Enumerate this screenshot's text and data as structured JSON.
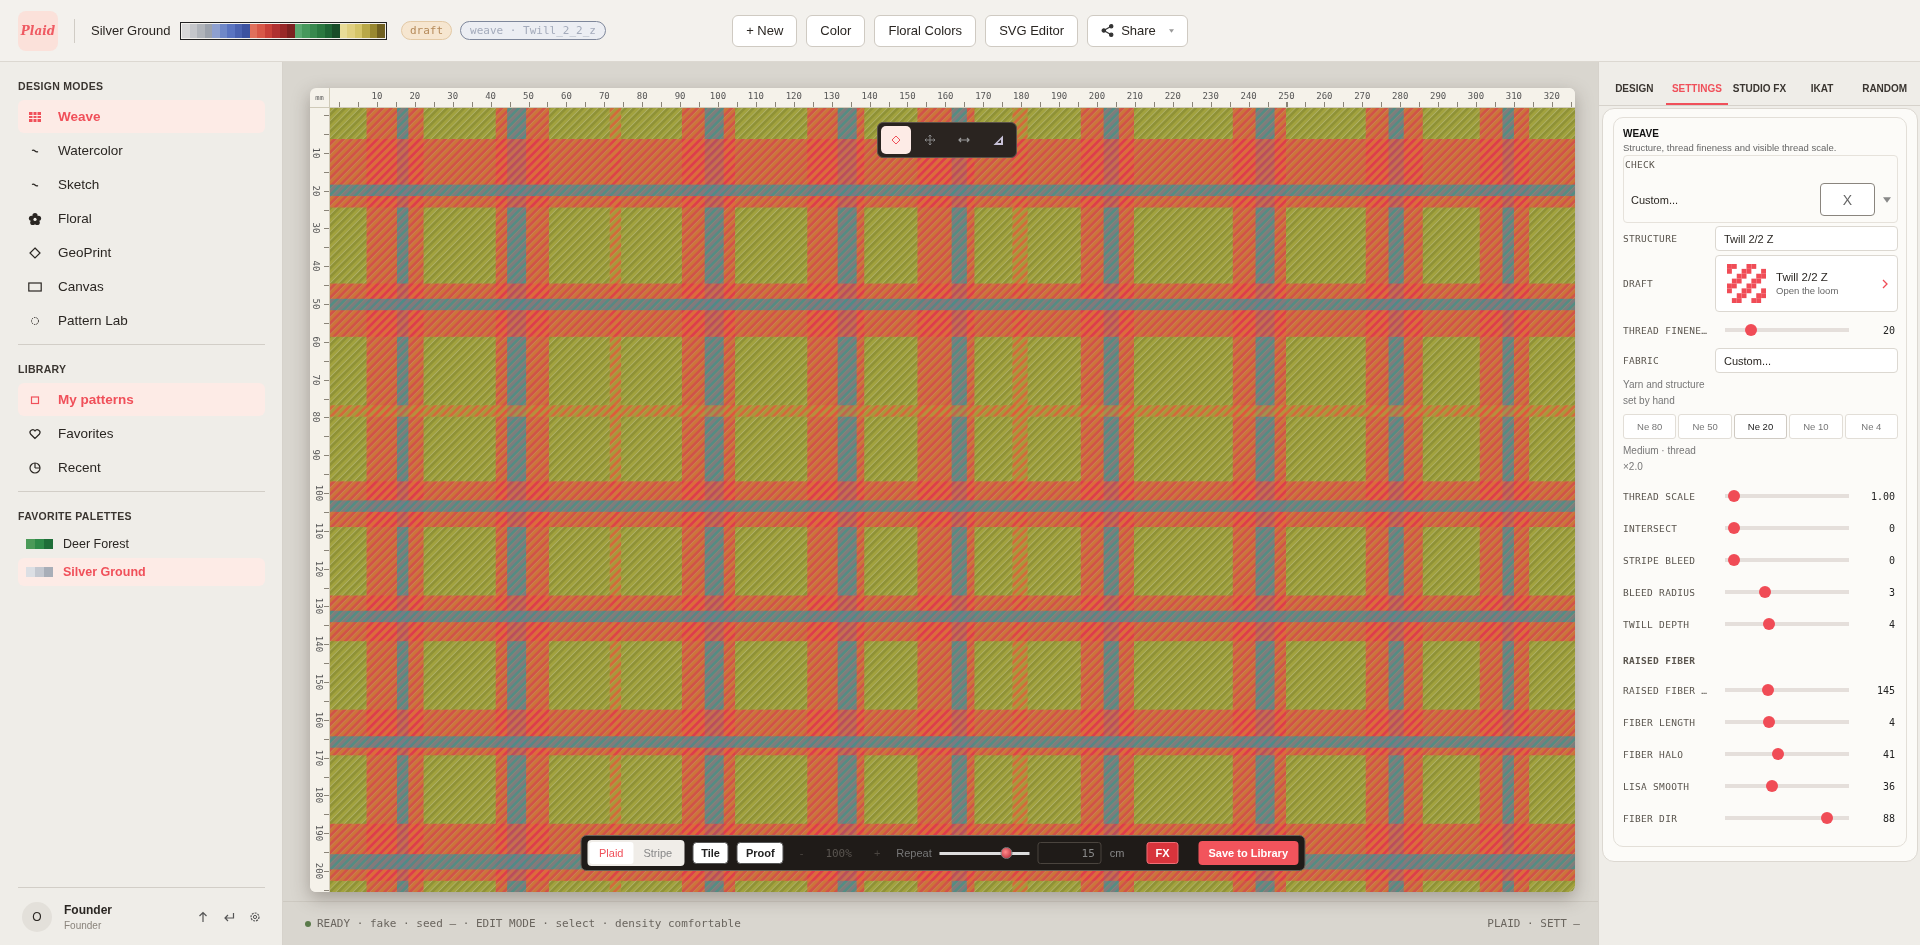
{
  "top_bar": {
    "logo": "Plaid",
    "palette_name": "Silver Ground",
    "palette_swatches": [
      {
        "color": "#d8d8d8"
      },
      {
        "color": "#c4c6ca"
      },
      {
        "color": "#b0b4ba"
      },
      {
        "color": "#9ca2ac"
      },
      {
        "color": "#8ea0d0"
      },
      {
        "color": "#6f88c8"
      },
      {
        "color": "#5a74c0"
      },
      {
        "color": "#4a62b0"
      },
      {
        "color": "#3c52a0"
      },
      {
        "color": "#e0705c"
      },
      {
        "color": "#d85848"
      },
      {
        "color": "#c84038"
      },
      {
        "color": "#b03030"
      },
      {
        "color": "#982828"
      },
      {
        "color": "#7c2020"
      },
      {
        "color": "#5aa870"
      },
      {
        "color": "#46985c"
      },
      {
        "color": "#38884e"
      },
      {
        "color": "#2a7840"
      },
      {
        "color": "#1e6434"
      },
      {
        "color": "#184c28"
      },
      {
        "color": "#e8dc98"
      },
      {
        "color": "#e0d080"
      },
      {
        "color": "#d4c468"
      },
      {
        "color": "#b8a848"
      },
      {
        "color": "#988830"
      },
      {
        "color": "#706020"
      }
    ],
    "badge": "draft",
    "weave_tag": "weave · Twill_2_2_z",
    "buttons": [
      {
        "kind": "plain",
        "label": "+ New"
      },
      {
        "kind": "plain",
        "label": "Color"
      },
      {
        "kind": "plain",
        "label": "Floral Colors"
      },
      {
        "kind": "plain",
        "label": "SVG Editor"
      },
      {
        "kind": "share",
        "label": "Share"
      }
    ]
  },
  "sidebar": {
    "sections": [
      {
        "title": "DESIGN MODES",
        "items": [
          {
            "kind": "grid",
            "label": "Weave",
            "selected": true
          },
          {
            "kind": "squiggle",
            "label": "Watercolor",
            "selected": false
          },
          {
            "kind": "squiggle",
            "label": "Sketch",
            "selected": false
          },
          {
            "kind": "flower",
            "label": "Floral",
            "selected": false
          },
          {
            "kind": "diamond",
            "label": "GeoPrint",
            "selected": false
          },
          {
            "kind": "rectangle",
            "label": "Canvas",
            "selected": false
          },
          {
            "kind": "dotted-circle",
            "label": "Pattern Lab",
            "selected": false
          }
        ]
      },
      {
        "title": "LIBRARY",
        "items": [
          {
            "kind": "square",
            "label": "My patterns",
            "selected": true
          },
          {
            "kind": "heart",
            "label": "Favorites",
            "selected": false
          },
          {
            "kind": "clock",
            "label": "Recent",
            "selected": false
          }
        ]
      }
    ],
    "palettes": {
      "title": "FAVORITE PALETTES",
      "items": [
        {
          "label": "Deer Forest",
          "selected": false,
          "swatches": [
            {
              "color": "#4a9a58"
            },
            {
              "color": "#2e8a48"
            },
            {
              "color": "#1e6e38"
            }
          ]
        },
        {
          "label": "Silver Ground",
          "selected": true,
          "swatches": [
            {
              "color": "#dcdfe4"
            },
            {
              "color": "#c4c8d0"
            },
            {
              "color": "#a8aeb8"
            }
          ]
        }
      ]
    },
    "user": {
      "initial": "O",
      "name": "Founder",
      "role": "Founder"
    }
  },
  "canvas": {
    "ruler": {
      "unit": "mm",
      "x_labels": [
        "10",
        "20",
        "30",
        "40",
        "50",
        "60",
        "70",
        "80",
        "90",
        "100",
        "110",
        "120",
        "130",
        "140",
        "150",
        "160",
        "170",
        "180",
        "190",
        "200",
        "210",
        "220",
        "230",
        "240",
        "250",
        "260",
        "270",
        "280",
        "290",
        "300",
        "310",
        "320"
      ],
      "y_labels": [
        "10",
        "20",
        "30",
        "40",
        "50",
        "60",
        "70",
        "80",
        "90",
        "100",
        "110",
        "120",
        "130",
        "140",
        "150",
        "160",
        "170",
        "180",
        "190",
        "200"
      ]
    },
    "tools": [
      {
        "kind": "select",
        "selected": true
      },
      {
        "kind": "move",
        "selected": false
      },
      {
        "kind": "resize",
        "selected": false
      },
      {
        "kind": "measure",
        "selected": false
      }
    ],
    "bottom_bar": {
      "modes": [
        {
          "label": "Plaid",
          "selected": true
        },
        {
          "label": "Stripe",
          "selected": false
        }
      ],
      "toggles": [
        "Tile",
        "Proof"
      ],
      "zoom": {
        "minus": "-",
        "value": "100%",
        "plus": "+",
        "disabled": true
      },
      "repeat": {
        "label": "Repeat",
        "level": 0.78,
        "placeholder": "15",
        "unit": "cm"
      },
      "fx": "FX",
      "save": "Save to Library"
    }
  },
  "status_bar": {
    "left": "READY · fake · seed — · EDIT MODE · select · density comfortable",
    "right": "PLAID · SETT —"
  },
  "panel": {
    "tabs": [
      {
        "label": "DESIGN",
        "selected": false
      },
      {
        "label": "SETTINGS",
        "selected": true
      },
      {
        "label": "STUDIO FX",
        "selected": false
      },
      {
        "label": "IKAT",
        "selected": false
      },
      {
        "label": "RANDOM",
        "selected": false
      }
    ],
    "title": "WEAVE",
    "subtitle": "Structure, thread fineness and visible thread scale.",
    "check": {
      "label": "CHECK",
      "value": "Custom...",
      "box": "X"
    },
    "structure": {
      "label": "STRUCTURE",
      "value": "Twill 2/2 Z"
    },
    "draft": {
      "label": "DRAFT",
      "title": "Twill 2/2 Z",
      "subtitle": "Open the loom"
    },
    "fineness": {
      "label": "THREAD FINENE…",
      "level": 0.18,
      "reading": "20"
    },
    "fabric": {
      "label": "FABRIC",
      "value": "Custom..."
    },
    "fabric_note": "Yarn and structure set by hand",
    "counts": [
      {
        "label": "Ne 80",
        "selected": false
      },
      {
        "label": "Ne 50",
        "selected": false
      },
      {
        "label": "Ne 20",
        "selected": true
      },
      {
        "label": "Ne 10",
        "selected": false
      },
      {
        "label": "Ne 4",
        "selected": false
      }
    ],
    "count_note": "Medium · thread ×2.0",
    "controls": [
      {
        "kind": "slider",
        "label": "THREAD SCALE",
        "level": 0.03,
        "reading": "1.00"
      },
      {
        "kind": "slider",
        "label": "INTERSECT",
        "level": 0.03,
        "reading": "0"
      },
      {
        "kind": "slider",
        "label": "STRIPE BLEED",
        "level": 0.03,
        "reading": "0"
      },
      {
        "kind": "slider",
        "label": "BLEED RADIUS",
        "level": 0.3,
        "reading": "3"
      },
      {
        "kind": "slider",
        "label": "TWILL DEPTH",
        "level": 0.34,
        "reading": "4"
      },
      {
        "kind": "heading",
        "label": "RAISED FIBER"
      },
      {
        "kind": "slider",
        "label": "RAISED FIBER …",
        "level": 0.33,
        "reading": "145"
      },
      {
        "kind": "slider",
        "label": "FIBER LENGTH",
        "level": 0.34,
        "reading": "4"
      },
      {
        "kind": "slider",
        "label": "FIBER HALO",
        "level": 0.42,
        "reading": "41"
      },
      {
        "kind": "slider",
        "label": "LISA SMOOTH",
        "level": 0.37,
        "reading": "36"
      },
      {
        "kind": "slider",
        "label": "FIBER DIR",
        "level": 0.86,
        "reading": "88"
      }
    ]
  }
}
